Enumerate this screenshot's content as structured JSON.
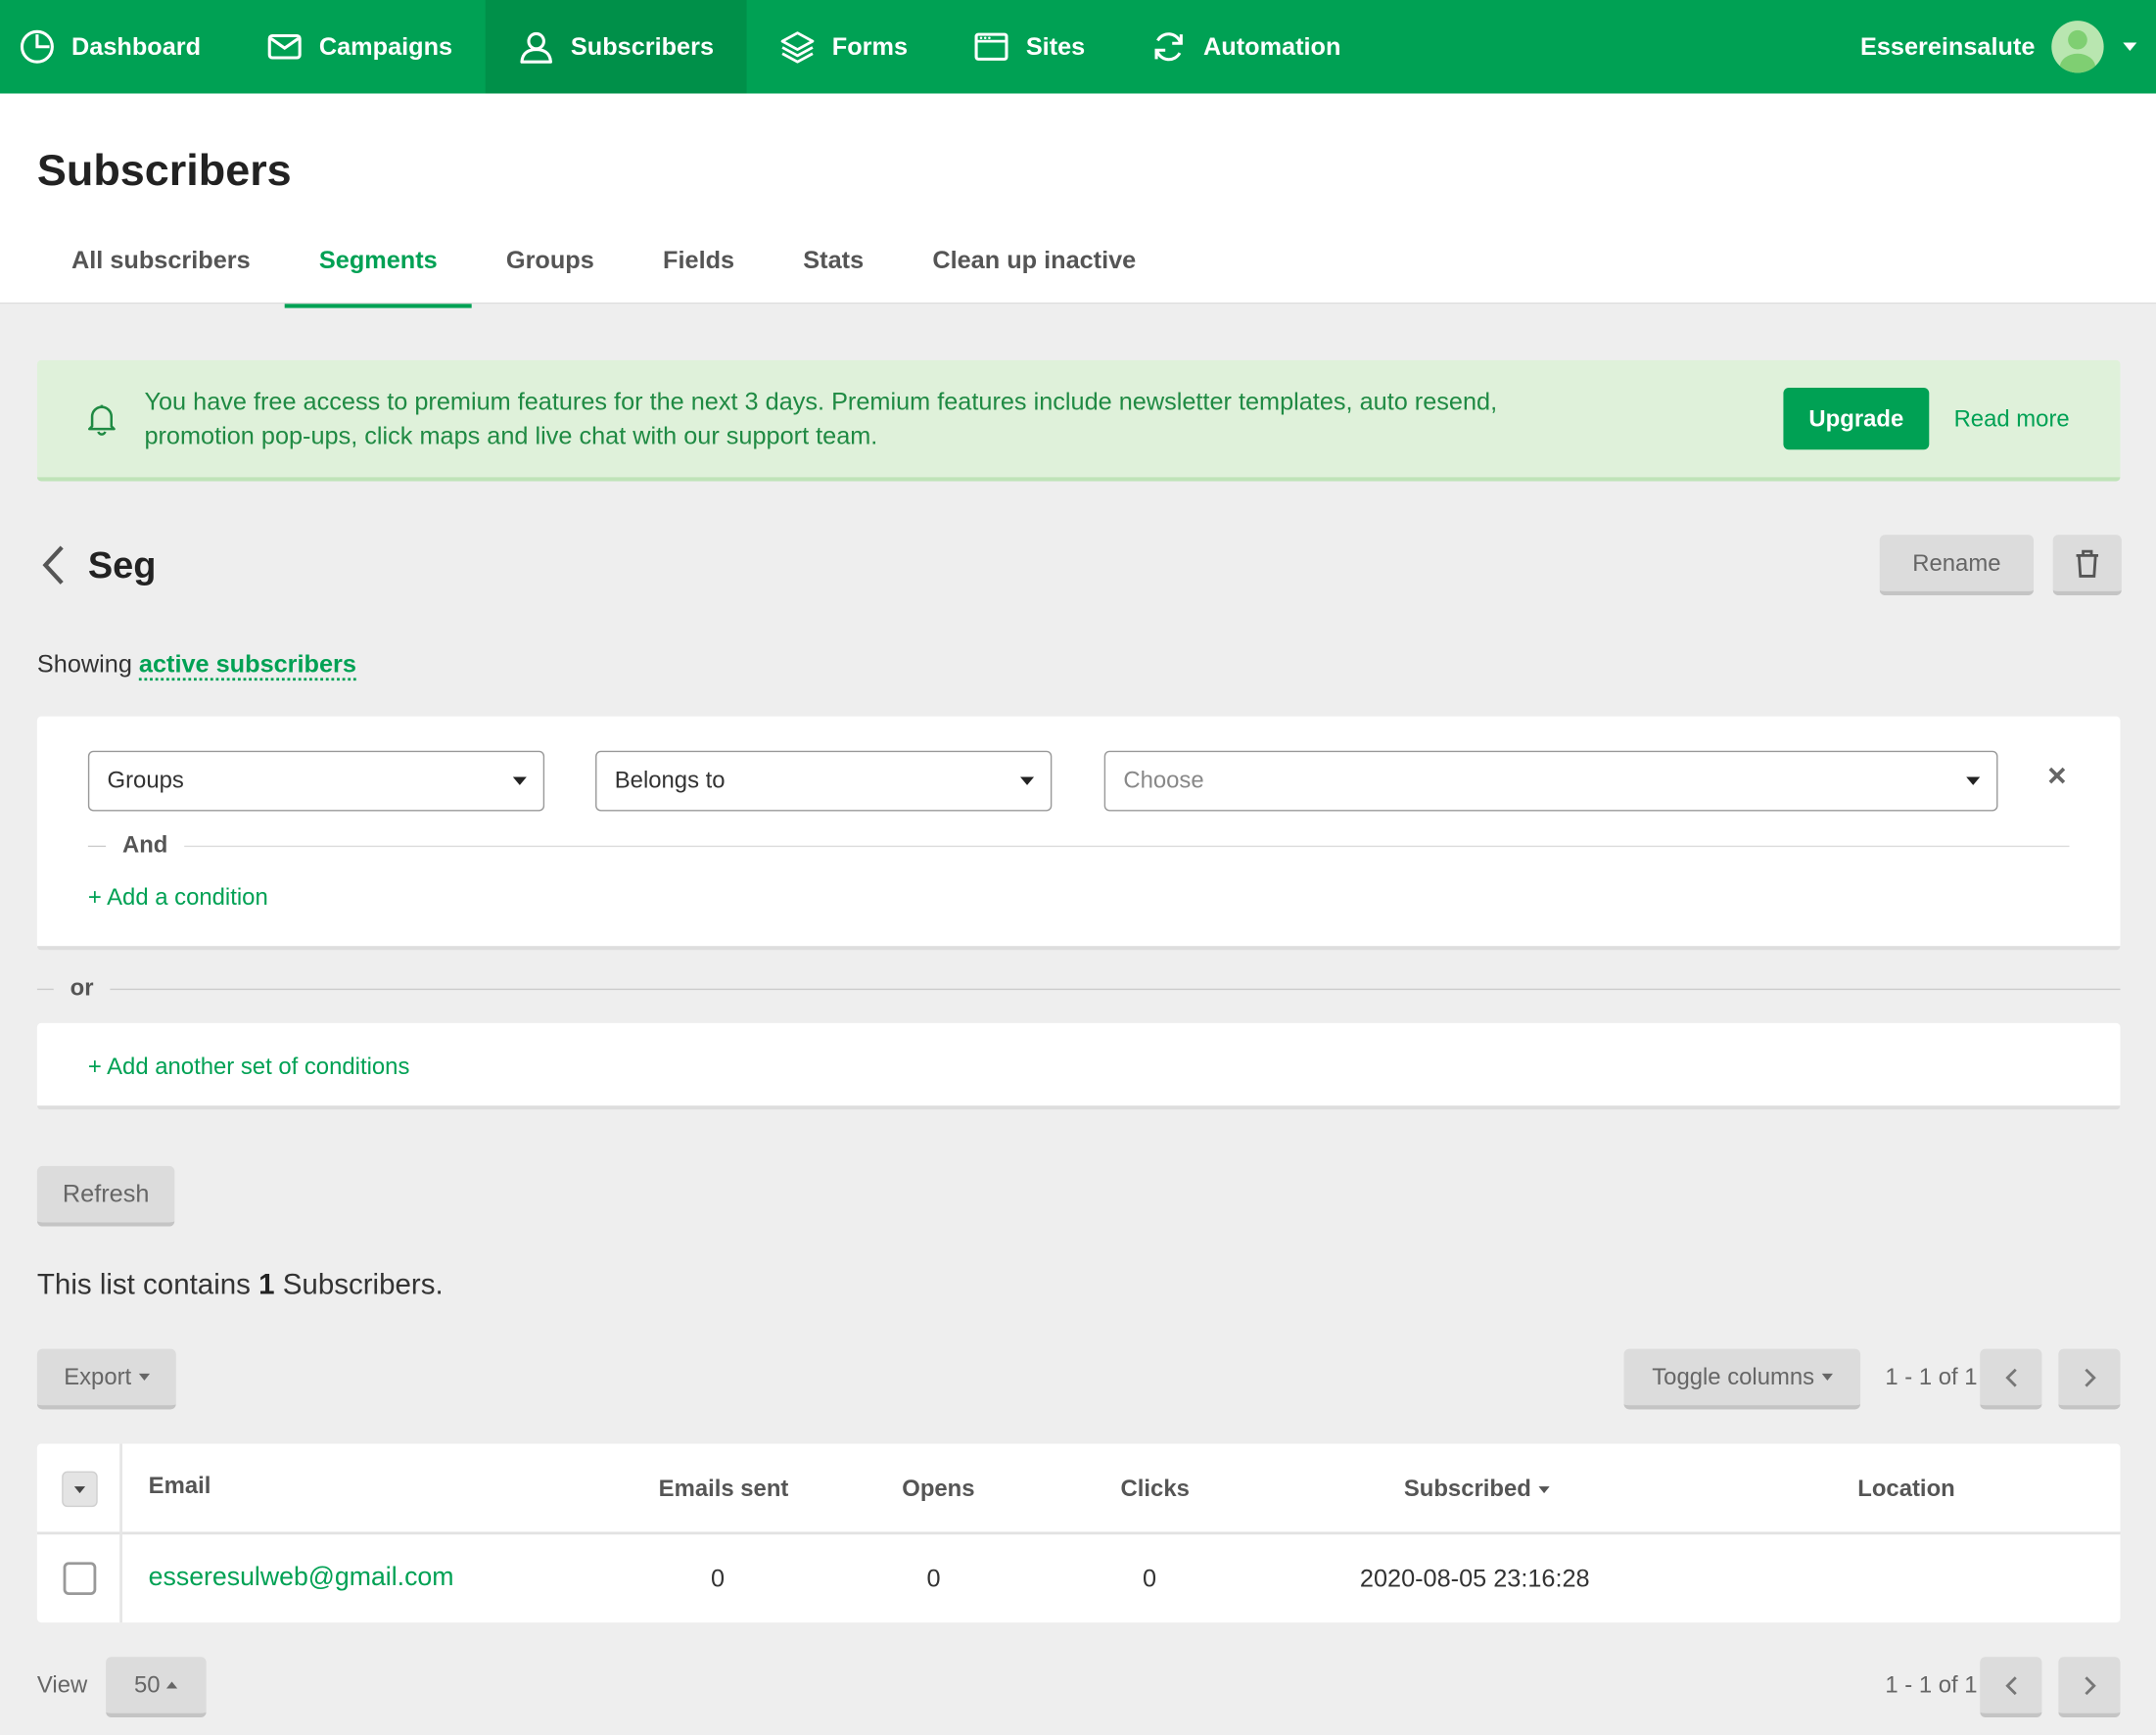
{
  "nav": {
    "items": [
      {
        "label": "Dashboard",
        "icon": "dashboard-icon"
      },
      {
        "label": "Campaigns",
        "icon": "envelope-icon"
      },
      {
        "label": "Subscribers",
        "icon": "user-icon"
      },
      {
        "label": "Forms",
        "icon": "layers-icon"
      },
      {
        "label": "Sites",
        "icon": "browser-icon"
      },
      {
        "label": "Automation",
        "icon": "refresh-icon"
      }
    ],
    "active": "Subscribers",
    "account_name": "Essereinsalute"
  },
  "page": {
    "title": "Subscribers",
    "tabs": [
      "All subscribers",
      "Segments",
      "Groups",
      "Fields",
      "Stats",
      "Clean up inactive"
    ],
    "active_tab": "Segments"
  },
  "banner": {
    "text": "You have free access to premium features for the next 3 days. Premium features include newsletter templates, auto resend, promotion pop-ups, click maps and live chat with our support team.",
    "upgrade_label": "Upgrade",
    "read_more_label": "Read more"
  },
  "segment": {
    "name": "Seg",
    "rename_label": "Rename",
    "showing_prefix": "Showing",
    "showing_link": "active subscribers",
    "conditions": {
      "field": "Groups",
      "operator": "Belongs to",
      "value_placeholder": "Choose"
    },
    "and_label": "And",
    "add_condition_label": "+ Add a condition",
    "or_label": "or",
    "add_set_label": "+ Add another set of conditions",
    "refresh_label": "Refresh"
  },
  "list": {
    "count_prefix": "This list contains",
    "count": "1",
    "count_suffix": "Subscribers.",
    "export_label": "Export",
    "toggle_columns_label": "Toggle columns",
    "pager_text": "1 - 1 of 1",
    "view_label": "View",
    "view_value": "50"
  },
  "table": {
    "columns": [
      "Email",
      "Emails sent",
      "Opens",
      "Clicks",
      "Subscribed",
      "Location"
    ],
    "rows": [
      {
        "email": "esseresulweb@gmail.com",
        "emails_sent": "0",
        "opens": "0",
        "clicks": "0",
        "subscribed": "2020-08-05 23:16:28",
        "location": ""
      }
    ]
  },
  "colors": {
    "brand": "#00a154",
    "brand_dark": "#009049",
    "banner_bg": "#dff1da",
    "page_bg": "#eeeeee"
  }
}
